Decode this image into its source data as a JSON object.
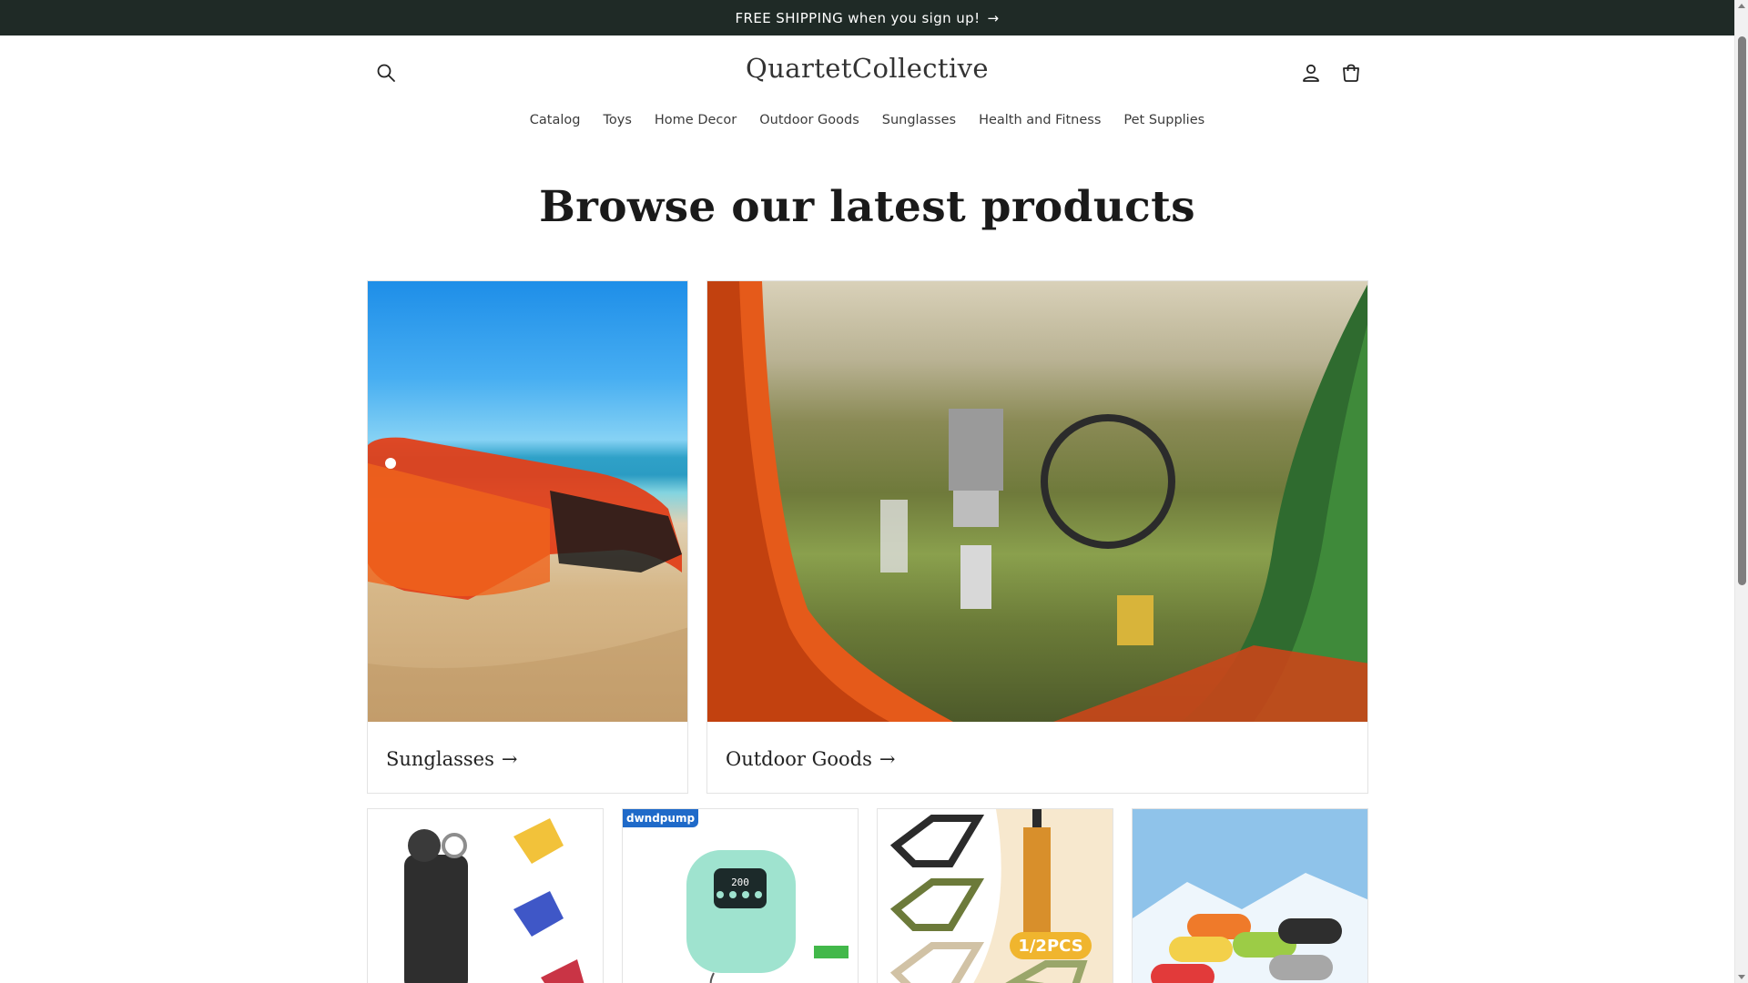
{
  "announcement": {
    "text": "FREE SHIPPING when you sign up!",
    "arrow": "→"
  },
  "header": {
    "logo": "QuartetCollective",
    "icons": [
      "search-icon",
      "account-icon",
      "cart-icon"
    ]
  },
  "nav": {
    "items": [
      "Catalog",
      "Toys",
      "Home Decor",
      "Outdoor Goods",
      "Sunglasses",
      "Health and Fitness",
      "Pet Supplies"
    ]
  },
  "main": {
    "heading": "Browse our latest products",
    "collections": [
      {
        "label": "Sunglasses",
        "arrow": "→"
      },
      {
        "label": "Outdoor Goods",
        "arrow": "→"
      }
    ],
    "products": [
      {
        "badge": ""
      },
      {
        "badge": "dwndpump",
        "display": "200"
      },
      {
        "badge": "",
        "tag": "1/2PCS"
      },
      {
        "badge": ""
      }
    ]
  },
  "colors": {
    "announcement_bg": "#1f2a26",
    "badge_blue": "#1f6ac9"
  }
}
